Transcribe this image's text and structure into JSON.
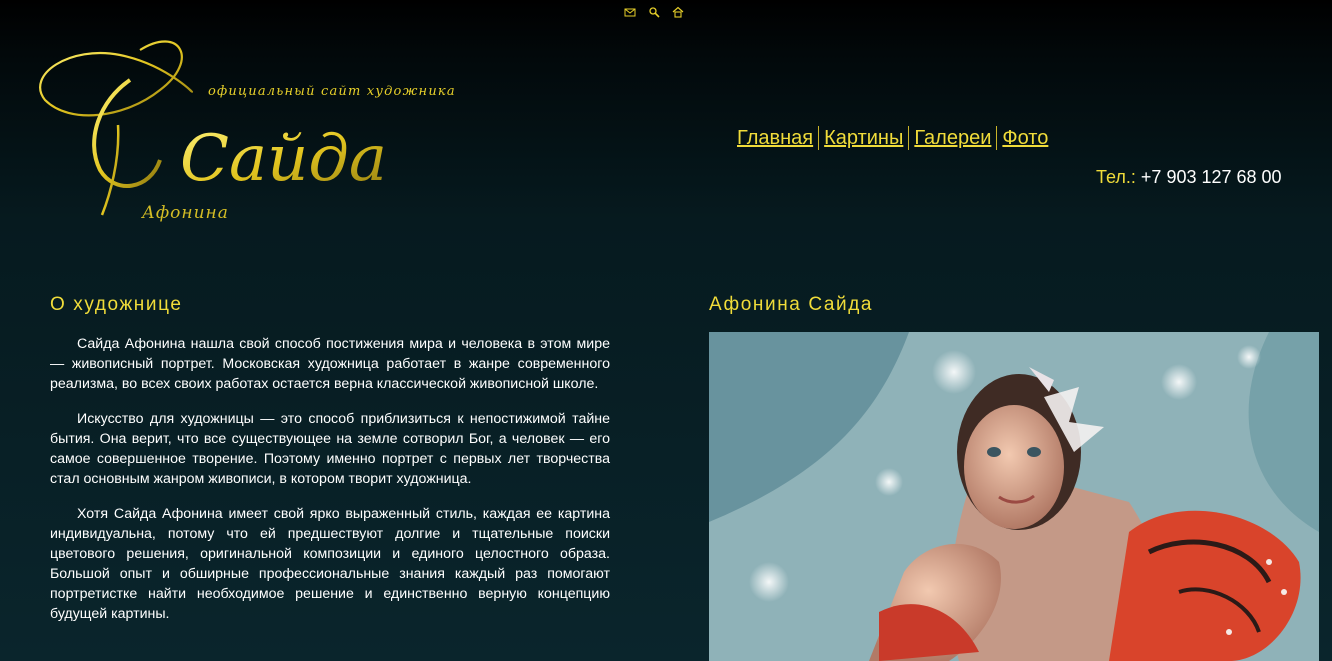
{
  "top_icons": [
    "mail-icon",
    "search-icon",
    "home-icon"
  ],
  "logo": {
    "tagline": "официальный сайт художника",
    "name": "Сайда",
    "surname": "Афонина"
  },
  "nav": {
    "items": [
      "Главная",
      "Картины",
      "Галереи",
      "Фото"
    ]
  },
  "contact": {
    "phone_label": "Тел.:",
    "phone_number": "+7 903 127 68 00"
  },
  "about": {
    "title": "О художнице",
    "paragraphs": [
      "Сайда Афонина нашла свой способ постижения мира и человека в этом мире — живописный портрет. Московская художница работает в жанре современного реализма, во всех своих работах остается верна классической живописной школе.",
      "Искусство для художницы — это способ приблизиться к непостижимой тайне бытия. Она верит, что все существующее на земле сотворил Бог, а человек — его самое совершенное творение. Поэтому именно портрет с первых лет творчества стал основным жанром живописи, в котором творит художница.",
      "Хотя Сайда Афонина имеет свой ярко выраженный стиль, каждая ее картина индивидуальна, потому что ей предшествуют долгие и тщательные поиски цветового решения, оригинальной композиции и единого целостного образа. Большой опыт и обширные профессиональные знания каждый раз помогают портретистке найти необходимое решение и единственно верную концепцию будущей картины."
    ]
  },
  "feature": {
    "title": "Афонина Сайда"
  },
  "colors": {
    "accent": "#f0dc3a",
    "background": "#0a252c"
  }
}
